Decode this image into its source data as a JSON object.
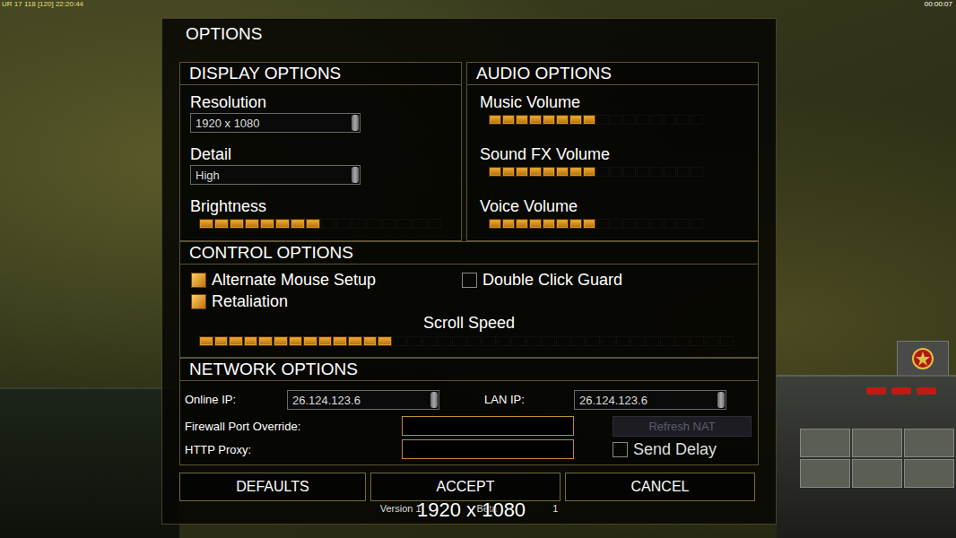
{
  "hud": {
    "top_left": "UR 17 118 [120] 22:20:44",
    "top_right": "00:00:07"
  },
  "dialog": {
    "title": "OPTIONS"
  },
  "display": {
    "header": "DISPLAY OPTIONS",
    "fields": [
      {
        "kind": "dropdown",
        "label": "Resolution",
        "value": "1920 x 1080"
      },
      {
        "kind": "dropdown",
        "label": "Detail",
        "value": "High"
      },
      {
        "kind": "slider",
        "label": "Brightness",
        "level": 0.5
      }
    ]
  },
  "audio": {
    "header": "AUDIO OPTIONS",
    "sliders": [
      {
        "label": "Music Volume",
        "level": 0.5
      },
      {
        "label": "Sound FX Volume",
        "level": 0.5
      },
      {
        "label": "Voice Volume",
        "level": 0.5
      }
    ]
  },
  "control": {
    "header": "CONTROL OPTIONS",
    "checkboxes": [
      {
        "label": "Alternate Mouse Setup",
        "checked": true
      },
      {
        "label": "Retaliation",
        "checked": true
      },
      {
        "label": "Double Click Guard",
        "checked": false
      }
    ],
    "scroll": {
      "label": "Scroll Speed",
      "level": 0.36
    }
  },
  "network": {
    "header": "NETWORK OPTIONS",
    "ips": [
      {
        "label": "Online IP:",
        "value": "26.124.123.6"
      },
      {
        "label": "LAN IP:",
        "value": "26.124.123.6"
      }
    ],
    "inputs": [
      {
        "label": "Firewall Port Override:",
        "value": ""
      },
      {
        "label": "HTTP Proxy:",
        "value": ""
      }
    ],
    "refresh": {
      "label": "Refresh NAT",
      "disabled": true
    },
    "send_delay": {
      "label": "Send Delay",
      "checked": false
    }
  },
  "buttons": [
    "DEFAULTS",
    "ACCEPT",
    "CANCEL"
  ],
  "version_parts": [
    "Version 1",
    "Beta",
    "1"
  ],
  "overlay": "1920 x 1080"
}
